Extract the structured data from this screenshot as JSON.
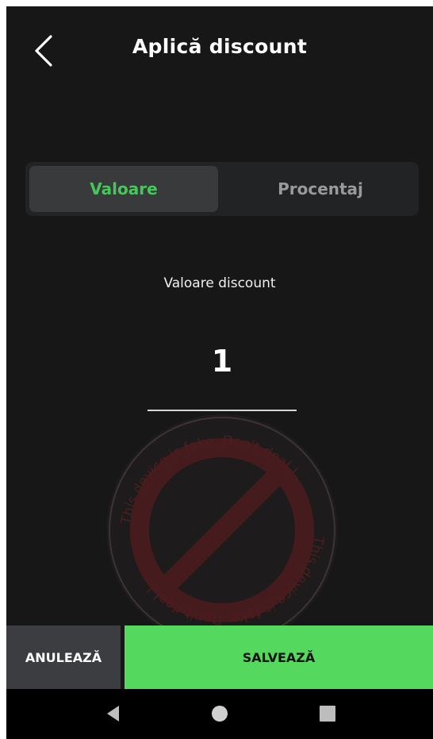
{
  "header": {
    "title": "Aplică discount",
    "back_icon": "chevron-left-icon"
  },
  "mode_toggle": {
    "options": [
      {
        "label": "Valoare",
        "active": true
      },
      {
        "label": "Procentaj",
        "active": false
      }
    ],
    "active_color": "#47c75a",
    "inactive_color": "#9a9a9a"
  },
  "discount_field": {
    "label": "Valoare discount",
    "value": "1"
  },
  "actions": {
    "cancel_label": "ANULEAZĂ",
    "save_label": "SALVEAZĂ",
    "save_color": "#55d85e",
    "cancel_color": "#3c3d40"
  },
  "watermark": {
    "text_top": "This device is fake. Don't deal !",
    "text_bottom": "This device is fake. Don't deal !",
    "icon": "prohibited-sign-icon"
  },
  "system_nav": {
    "buttons": [
      "back-triangle-icon",
      "home-circle-icon",
      "recents-square-icon"
    ]
  }
}
